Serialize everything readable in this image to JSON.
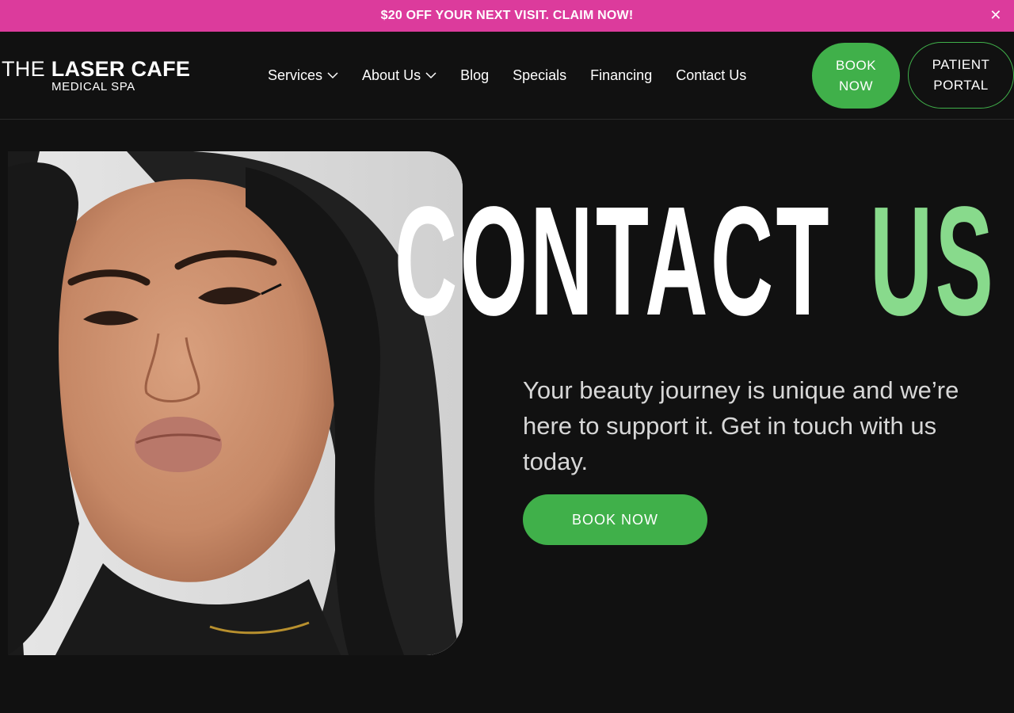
{
  "promo": {
    "text": "$20 OFF YOUR NEXT VISIT. CLAIM NOW!",
    "close_icon": "close-icon",
    "close_glyph": "✕"
  },
  "logo": {
    "line1_light": "THE ",
    "line1_bold": "LASER CAFE",
    "line2": "MEDICAL SPA"
  },
  "nav": {
    "items": [
      {
        "label": "Services",
        "has_dropdown": true
      },
      {
        "label": "About Us",
        "has_dropdown": true
      },
      {
        "label": "Blog",
        "has_dropdown": false
      },
      {
        "label": "Specials",
        "has_dropdown": false
      },
      {
        "label": "Financing",
        "has_dropdown": false
      },
      {
        "label": "Contact Us",
        "has_dropdown": false
      }
    ]
  },
  "header_buttons": {
    "book_line1": "BOOK",
    "book_line2": "NOW",
    "portal_line1": "PATIENT",
    "portal_line2": "PORTAL"
  },
  "hero": {
    "title_white": "CONTACT",
    "title_green": "US",
    "subtitle": "Your beauty journey is unique and we’re here to support it. Get in touch with us today.",
    "cta": "BOOK NOW"
  },
  "colors": {
    "promo_bg": "#dc3b9c",
    "page_bg": "#111111",
    "accent_green": "#40b04a",
    "title_green": "#88da8c"
  }
}
